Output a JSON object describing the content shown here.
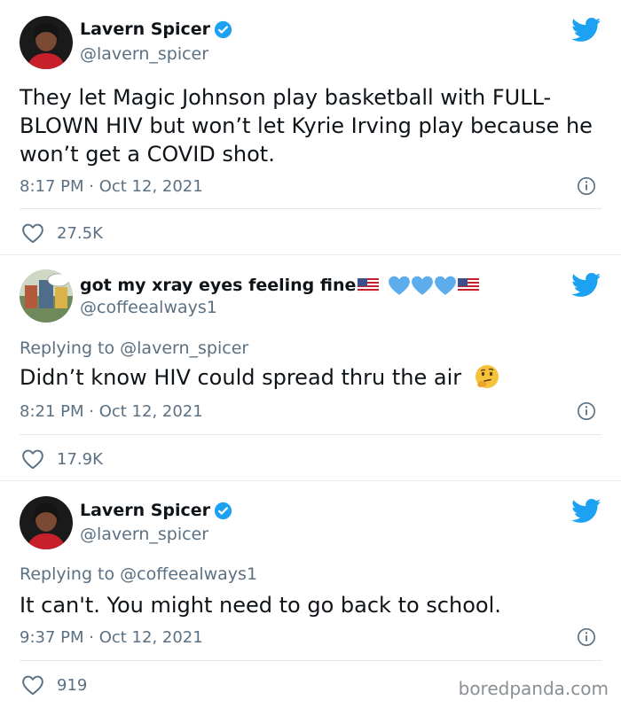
{
  "tweets": [
    {
      "name": "Lavern Spicer",
      "handle": "@lavern_spicer",
      "replying": "",
      "text": "They let Magic Johnson play basketball with FULL-BLOWN HIV but won’t let Kyrie Irving play because he won’t get a COVID shot.",
      "time": "8:17 PM · Oct 12, 2021",
      "likes": "27.5K"
    },
    {
      "name": "got my xray eyes feeling fine",
      "handle": "@coffeealways1",
      "replying": "Replying to @lavern_spicer",
      "text": "Didn’t know HIV could spread thru the air",
      "time": "8:21 PM · Oct 12, 2021",
      "likes": "17.9K"
    },
    {
      "name": "Lavern Spicer",
      "handle": "@lavern_spicer",
      "replying": "Replying to @coffeealways1",
      "text": "It can't. You might need to go back to school.",
      "time": "9:37 PM · Oct 12, 2021",
      "likes": "919"
    }
  ],
  "watermark": "boredpanda.com",
  "colors": {
    "twitter_blue": "#1da1f2",
    "text": "#0f1419",
    "muted": "#5b7083"
  }
}
